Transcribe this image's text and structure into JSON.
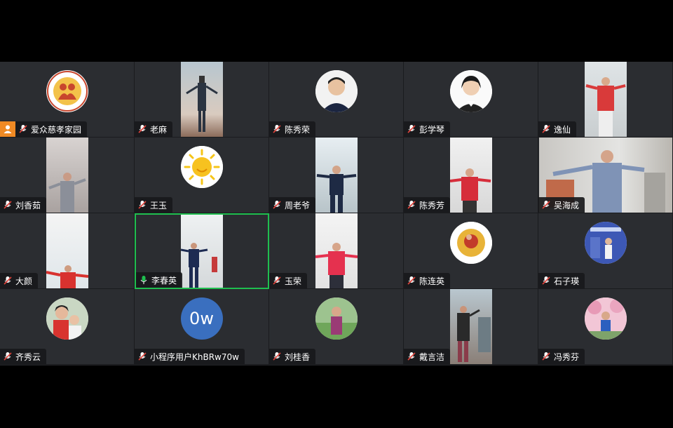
{
  "meeting": {
    "participants": [
      {
        "name": "爱众慈孝家园",
        "mic": "muted",
        "media": "logo",
        "host": true
      },
      {
        "name": "老麻",
        "mic": "muted",
        "media": "video"
      },
      {
        "name": "陈秀荣",
        "mic": "muted",
        "media": "avatar-photo"
      },
      {
        "name": "彭学琴",
        "mic": "muted",
        "media": "avatar-photo"
      },
      {
        "name": "逸仙",
        "mic": "muted",
        "media": "video"
      },
      {
        "name": "刘香茹",
        "mic": "muted",
        "media": "video"
      },
      {
        "name": "王玉",
        "mic": "muted",
        "media": "avatar-sun"
      },
      {
        "name": "周老爷",
        "mic": "muted",
        "media": "video"
      },
      {
        "name": "陈秀芳",
        "mic": "muted",
        "media": "video"
      },
      {
        "name": "吴海成",
        "mic": "muted",
        "media": "video-wide"
      },
      {
        "name": "大颜",
        "mic": "muted",
        "media": "video"
      },
      {
        "name": "李春英",
        "mic": "active",
        "media": "video",
        "active_speaker": true
      },
      {
        "name": "玉荣",
        "mic": "muted",
        "media": "video"
      },
      {
        "name": "陈连英",
        "mic": "muted",
        "media": "avatar-photo"
      },
      {
        "name": "石子瑛",
        "mic": "muted",
        "media": "avatar-photo"
      },
      {
        "name": "齐秀云",
        "mic": "muted",
        "media": "avatar-photo"
      },
      {
        "name": "小程序用户KhBRw70w",
        "mic": "muted",
        "media": "initials",
        "initials": "0w"
      },
      {
        "name": "刘桂香",
        "mic": "muted",
        "media": "avatar-photo"
      },
      {
        "name": "戴言洁",
        "mic": "muted",
        "media": "video"
      },
      {
        "name": "冯秀芬",
        "mic": "muted",
        "media": "avatar-photo"
      }
    ]
  },
  "colors": {
    "active_border": "#1fbf4f",
    "muted_mic": "#e0433b",
    "host_badge": "#f08a24",
    "initials_bg": "#3a6fbf"
  },
  "icons": [
    "mic-muted-icon",
    "mic-on-icon",
    "host-icon"
  ]
}
